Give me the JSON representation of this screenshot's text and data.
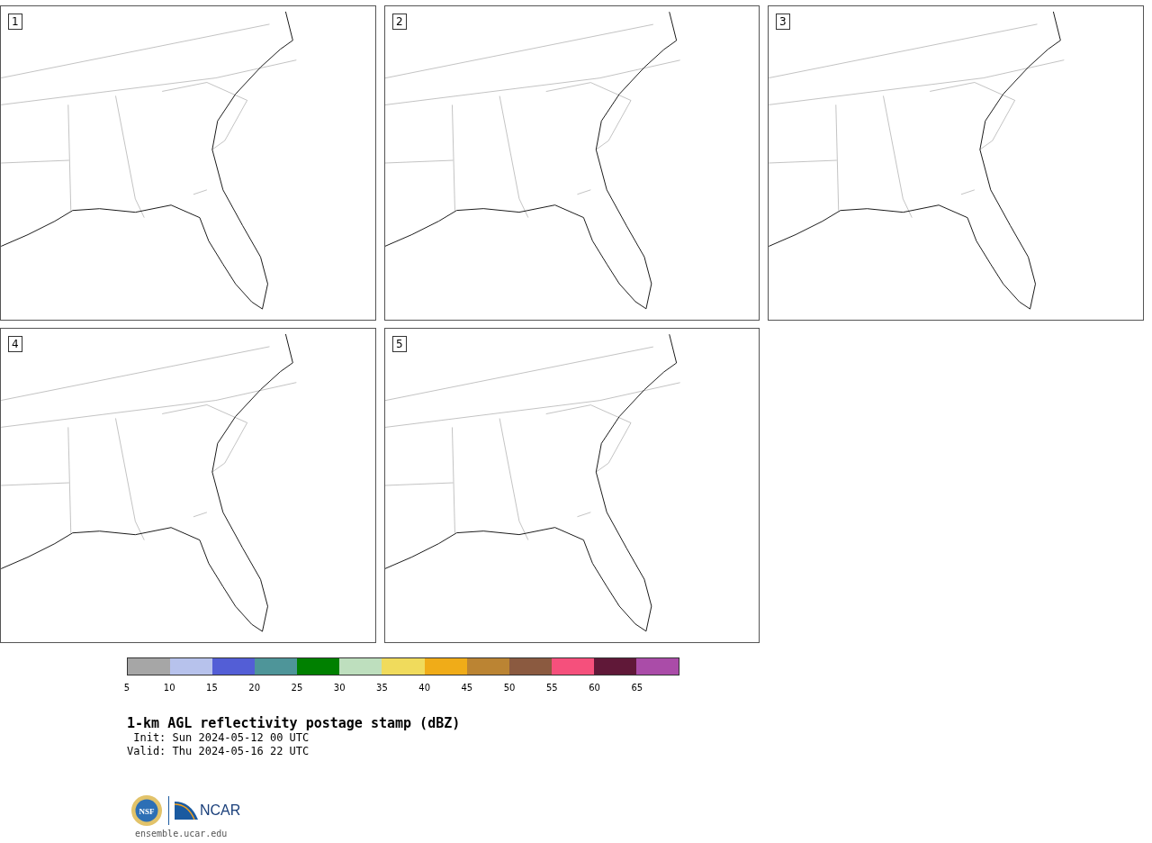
{
  "panels": [
    {
      "label": "1"
    },
    {
      "label": "2"
    },
    {
      "label": "3"
    },
    {
      "label": "4"
    },
    {
      "label": "5"
    }
  ],
  "colorbar": {
    "bins": [
      {
        "color": "#a6a6a6"
      },
      {
        "color": "#b7c2ec"
      },
      {
        "color": "#535ed6"
      },
      {
        "color": "#4e9599"
      },
      {
        "color": "#008000"
      },
      {
        "color": "#bedfbe"
      },
      {
        "color": "#f0db5c"
      },
      {
        "color": "#f0ac18"
      },
      {
        "color": "#bb8433"
      },
      {
        "color": "#8b5a40"
      },
      {
        "color": "#f5507c"
      },
      {
        "color": "#601838"
      },
      {
        "color": "#aa4ca8"
      }
    ],
    "ticks": [
      "5",
      "10",
      "15",
      "20",
      "25",
      "30",
      "35",
      "40",
      "45",
      "50",
      "55",
      "60",
      "65"
    ]
  },
  "title": "1-km AGL reflectivity postage stamp (dBZ)",
  "init": " Init: Sun 2024-05-12 00 UTC",
  "valid": "Valid: Thu 2024-05-16 22 UTC",
  "logos": {
    "nsf": "NSF",
    "ncar": "NCAR"
  },
  "url": "ensemble.ucar.edu"
}
